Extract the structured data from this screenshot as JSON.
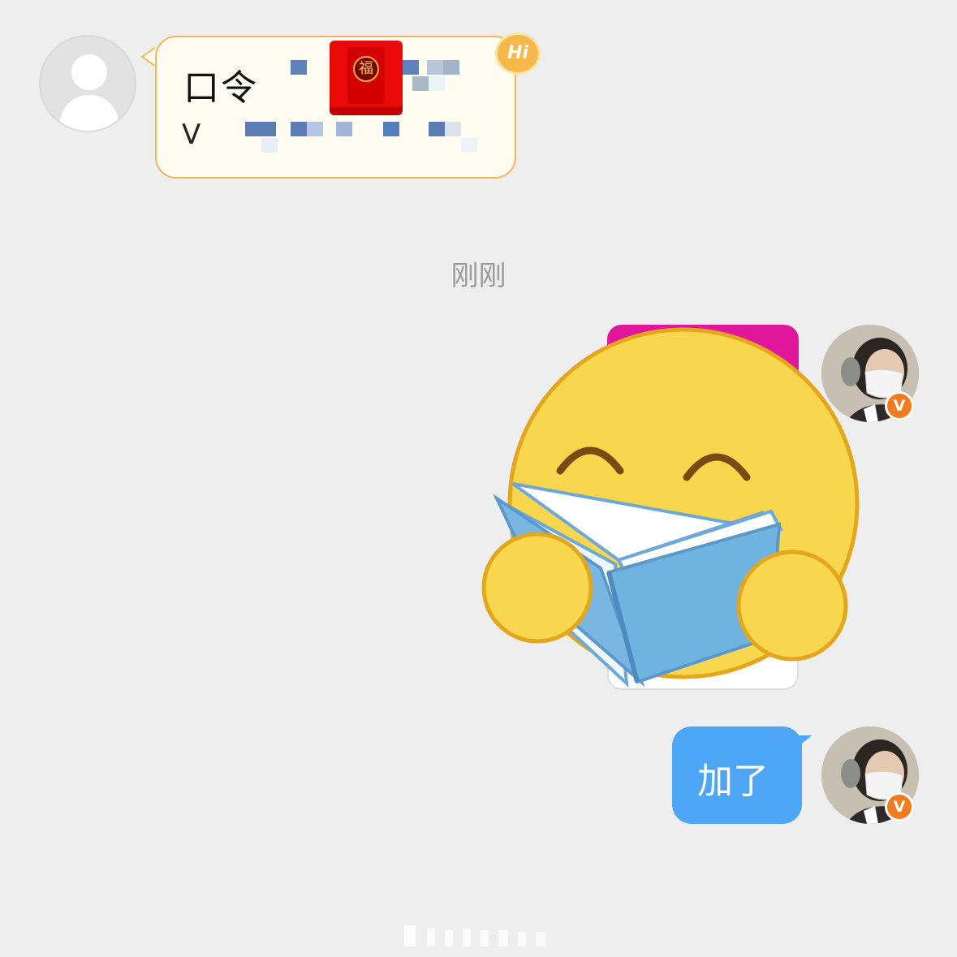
{
  "incoming": {
    "line1": "口令",
    "line2": "V",
    "red_packet_char": "福",
    "hi_badge": "Hi",
    "colors": {
      "bubble_border": "#f0b758",
      "bubble_bg": "#fefbf1",
      "red_packet": "#ea0a0a"
    },
    "icons": [
      "default-avatar-icon",
      "red-packet-icon",
      "hi-badge-icon"
    ]
  },
  "timestamp": "刚刚",
  "outgoing": {
    "sticker": "reading-book-emoji",
    "verified_badge": "V",
    "text_message": "加了",
    "colors": {
      "bubble_bg": "#4ca5f5",
      "verified": "#f27b1f",
      "sticker_card_top": "#e0179a"
    }
  }
}
